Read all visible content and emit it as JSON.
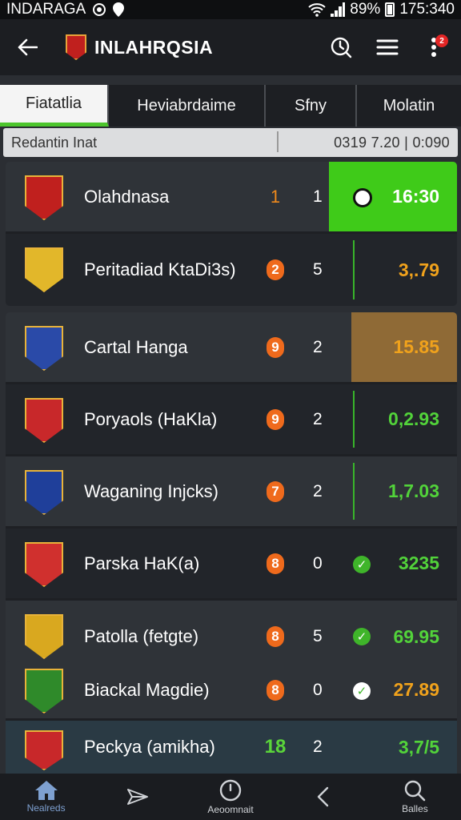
{
  "status_bar": {
    "carrier": "INDARAGA",
    "battery": "89%",
    "time": "175:340"
  },
  "app_bar": {
    "title": "INLAHRQSIA"
  },
  "notification_count": "2",
  "tabs": [
    {
      "label": "Fiatatlia",
      "active": true
    },
    {
      "label": "Heviabrdaime",
      "active": false
    },
    {
      "label": "Sfny",
      "active": false
    },
    {
      "label": "Molatin",
      "active": false
    }
  ],
  "filter": {
    "label": "Redantin Inat",
    "stats": "0319  7.20  |  0:090"
  },
  "cards": [
    {
      "rows": [
        {
          "team": "Olahdnasa",
          "rank": "1",
          "points": "1",
          "odds": "16:30",
          "crest_color": "#c0201e"
        },
        {
          "team": "Peritadiad KtaDi3s)",
          "rank": "2",
          "points": "5",
          "odds": "3,.79",
          "crest_color": "#e2b72a"
        }
      ]
    },
    {
      "rows": [
        {
          "team": "Cartal Hanga",
          "rank": "9",
          "points": "2",
          "odds": "15.85",
          "crest_color": "#2a4aa8"
        },
        {
          "team": "Poryaols (HaKla)",
          "rank": "9",
          "points": "2",
          "odds": "0,2.93",
          "crest_color": "#c8282a"
        },
        {
          "team": "Waganing Injcks)",
          "rank": "7",
          "points": "2",
          "odds": "1,7.03",
          "crest_color": "#1f3f9a"
        },
        {
          "team": "Parska HaK(a)",
          "rank": "8",
          "points": "0",
          "odds": "3235",
          "crest_color": "#d0302e"
        },
        {
          "team": "Patolla (fetgte)",
          "rank": "8",
          "points": "5",
          "odds": "69.95",
          "crest_color": "#d9a81f"
        }
      ]
    },
    {
      "rows": [
        {
          "team": "Biackal Magdie)",
          "rank": "8",
          "points": "0",
          "odds": "27.89",
          "crest_color": "#2f8a2a"
        },
        {
          "team": "Peckya (amikha)",
          "rank": "18",
          "points": "2",
          "odds": "3,7/5",
          "crest_color": "#c8282a"
        }
      ]
    }
  ],
  "bottom_nav": [
    {
      "label": "Nealreds",
      "icon": "home-icon",
      "active": true
    },
    {
      "label": "",
      "icon": "send-icon",
      "active": false
    },
    {
      "label": "Aeoomnait",
      "icon": "clock-icon",
      "active": false
    },
    {
      "label": "",
      "icon": "back-arrow-icon",
      "active": false
    },
    {
      "label": "Balles",
      "icon": "search-icon",
      "active": false
    }
  ]
}
